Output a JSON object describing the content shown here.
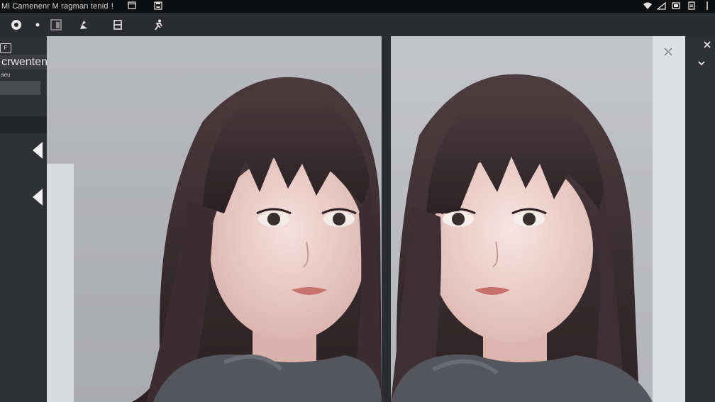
{
  "window": {
    "title": "Ml  Camenenr M  ragman tenid",
    "title_suffix": "!"
  },
  "toolbar": {
    "tools": [
      {
        "icon": "radio-record-icon"
      },
      {
        "icon": "dot-icon"
      },
      {
        "icon": "frame-icon"
      },
      {
        "icon": "brush-icon"
      },
      {
        "icon": "split-icon"
      },
      {
        "icon": "run-icon"
      }
    ]
  },
  "left_panel": {
    "badge": "F",
    "tab_label": "crwentenn",
    "tab_label_small": "aeu"
  },
  "right_panel": {
    "close_icon": "close-icon",
    "chevron_icon": "chevron-down-icon"
  },
  "compare": {
    "left_image": "portrait-before",
    "right_image": "portrait-after",
    "overlay_icon": "resize-icon"
  },
  "colors": {
    "topbar": "#0e0f11",
    "panel": "#2e3033",
    "hair": "#3a2b2d",
    "skin": "#f0d3cf",
    "sweater": "#55565b"
  }
}
